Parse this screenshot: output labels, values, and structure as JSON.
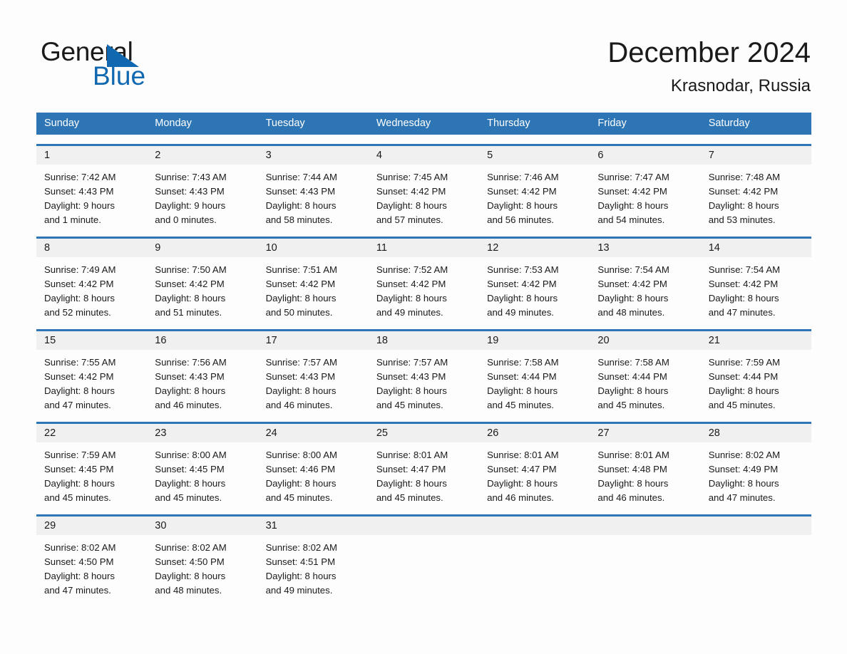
{
  "brand": {
    "name_part1": "General",
    "name_part2": "Blue",
    "accent_color": "#1068b0",
    "triangle_icon": "triangle-icon"
  },
  "header": {
    "month_title": "December 2024",
    "location": "Krasnodar, Russia"
  },
  "calendar": {
    "header_bg_color": "#2e75b6",
    "day_band_bg_color": "#f0f0f0",
    "weekdays": [
      "Sunday",
      "Monday",
      "Tuesday",
      "Wednesday",
      "Thursday",
      "Friday",
      "Saturday"
    ],
    "weeks": [
      [
        {
          "day": "1",
          "sunrise": "Sunrise: 7:42 AM",
          "sunset": "Sunset: 4:43 PM",
          "daylight_1": "Daylight: 9 hours",
          "daylight_2": "and 1 minute."
        },
        {
          "day": "2",
          "sunrise": "Sunrise: 7:43 AM",
          "sunset": "Sunset: 4:43 PM",
          "daylight_1": "Daylight: 9 hours",
          "daylight_2": "and 0 minutes."
        },
        {
          "day": "3",
          "sunrise": "Sunrise: 7:44 AM",
          "sunset": "Sunset: 4:43 PM",
          "daylight_1": "Daylight: 8 hours",
          "daylight_2": "and 58 minutes."
        },
        {
          "day": "4",
          "sunrise": "Sunrise: 7:45 AM",
          "sunset": "Sunset: 4:42 PM",
          "daylight_1": "Daylight: 8 hours",
          "daylight_2": "and 57 minutes."
        },
        {
          "day": "5",
          "sunrise": "Sunrise: 7:46 AM",
          "sunset": "Sunset: 4:42 PM",
          "daylight_1": "Daylight: 8 hours",
          "daylight_2": "and 56 minutes."
        },
        {
          "day": "6",
          "sunrise": "Sunrise: 7:47 AM",
          "sunset": "Sunset: 4:42 PM",
          "daylight_1": "Daylight: 8 hours",
          "daylight_2": "and 54 minutes."
        },
        {
          "day": "7",
          "sunrise": "Sunrise: 7:48 AM",
          "sunset": "Sunset: 4:42 PM",
          "daylight_1": "Daylight: 8 hours",
          "daylight_2": "and 53 minutes."
        }
      ],
      [
        {
          "day": "8",
          "sunrise": "Sunrise: 7:49 AM",
          "sunset": "Sunset: 4:42 PM",
          "daylight_1": "Daylight: 8 hours",
          "daylight_2": "and 52 minutes."
        },
        {
          "day": "9",
          "sunrise": "Sunrise: 7:50 AM",
          "sunset": "Sunset: 4:42 PM",
          "daylight_1": "Daylight: 8 hours",
          "daylight_2": "and 51 minutes."
        },
        {
          "day": "10",
          "sunrise": "Sunrise: 7:51 AM",
          "sunset": "Sunset: 4:42 PM",
          "daylight_1": "Daylight: 8 hours",
          "daylight_2": "and 50 minutes."
        },
        {
          "day": "11",
          "sunrise": "Sunrise: 7:52 AM",
          "sunset": "Sunset: 4:42 PM",
          "daylight_1": "Daylight: 8 hours",
          "daylight_2": "and 49 minutes."
        },
        {
          "day": "12",
          "sunrise": "Sunrise: 7:53 AM",
          "sunset": "Sunset: 4:42 PM",
          "daylight_1": "Daylight: 8 hours",
          "daylight_2": "and 49 minutes."
        },
        {
          "day": "13",
          "sunrise": "Sunrise: 7:54 AM",
          "sunset": "Sunset: 4:42 PM",
          "daylight_1": "Daylight: 8 hours",
          "daylight_2": "and 48 minutes."
        },
        {
          "day": "14",
          "sunrise": "Sunrise: 7:54 AM",
          "sunset": "Sunset: 4:42 PM",
          "daylight_1": "Daylight: 8 hours",
          "daylight_2": "and 47 minutes."
        }
      ],
      [
        {
          "day": "15",
          "sunrise": "Sunrise: 7:55 AM",
          "sunset": "Sunset: 4:42 PM",
          "daylight_1": "Daylight: 8 hours",
          "daylight_2": "and 47 minutes."
        },
        {
          "day": "16",
          "sunrise": "Sunrise: 7:56 AM",
          "sunset": "Sunset: 4:43 PM",
          "daylight_1": "Daylight: 8 hours",
          "daylight_2": "and 46 minutes."
        },
        {
          "day": "17",
          "sunrise": "Sunrise: 7:57 AM",
          "sunset": "Sunset: 4:43 PM",
          "daylight_1": "Daylight: 8 hours",
          "daylight_2": "and 46 minutes."
        },
        {
          "day": "18",
          "sunrise": "Sunrise: 7:57 AM",
          "sunset": "Sunset: 4:43 PM",
          "daylight_1": "Daylight: 8 hours",
          "daylight_2": "and 45 minutes."
        },
        {
          "day": "19",
          "sunrise": "Sunrise: 7:58 AM",
          "sunset": "Sunset: 4:44 PM",
          "daylight_1": "Daylight: 8 hours",
          "daylight_2": "and 45 minutes."
        },
        {
          "day": "20",
          "sunrise": "Sunrise: 7:58 AM",
          "sunset": "Sunset: 4:44 PM",
          "daylight_1": "Daylight: 8 hours",
          "daylight_2": "and 45 minutes."
        },
        {
          "day": "21",
          "sunrise": "Sunrise: 7:59 AM",
          "sunset": "Sunset: 4:44 PM",
          "daylight_1": "Daylight: 8 hours",
          "daylight_2": "and 45 minutes."
        }
      ],
      [
        {
          "day": "22",
          "sunrise": "Sunrise: 7:59 AM",
          "sunset": "Sunset: 4:45 PM",
          "daylight_1": "Daylight: 8 hours",
          "daylight_2": "and 45 minutes."
        },
        {
          "day": "23",
          "sunrise": "Sunrise: 8:00 AM",
          "sunset": "Sunset: 4:45 PM",
          "daylight_1": "Daylight: 8 hours",
          "daylight_2": "and 45 minutes."
        },
        {
          "day": "24",
          "sunrise": "Sunrise: 8:00 AM",
          "sunset": "Sunset: 4:46 PM",
          "daylight_1": "Daylight: 8 hours",
          "daylight_2": "and 45 minutes."
        },
        {
          "day": "25",
          "sunrise": "Sunrise: 8:01 AM",
          "sunset": "Sunset: 4:47 PM",
          "daylight_1": "Daylight: 8 hours",
          "daylight_2": "and 45 minutes."
        },
        {
          "day": "26",
          "sunrise": "Sunrise: 8:01 AM",
          "sunset": "Sunset: 4:47 PM",
          "daylight_1": "Daylight: 8 hours",
          "daylight_2": "and 46 minutes."
        },
        {
          "day": "27",
          "sunrise": "Sunrise: 8:01 AM",
          "sunset": "Sunset: 4:48 PM",
          "daylight_1": "Daylight: 8 hours",
          "daylight_2": "and 46 minutes."
        },
        {
          "day": "28",
          "sunrise": "Sunrise: 8:02 AM",
          "sunset": "Sunset: 4:49 PM",
          "daylight_1": "Daylight: 8 hours",
          "daylight_2": "and 47 minutes."
        }
      ],
      [
        {
          "day": "29",
          "sunrise": "Sunrise: 8:02 AM",
          "sunset": "Sunset: 4:50 PM",
          "daylight_1": "Daylight: 8 hours",
          "daylight_2": "and 47 minutes."
        },
        {
          "day": "30",
          "sunrise": "Sunrise: 8:02 AM",
          "sunset": "Sunset: 4:50 PM",
          "daylight_1": "Daylight: 8 hours",
          "daylight_2": "and 48 minutes."
        },
        {
          "day": "31",
          "sunrise": "Sunrise: 8:02 AM",
          "sunset": "Sunset: 4:51 PM",
          "daylight_1": "Daylight: 8 hours",
          "daylight_2": "and 49 minutes."
        },
        {
          "day": "",
          "sunrise": "",
          "sunset": "",
          "daylight_1": "",
          "daylight_2": ""
        },
        {
          "day": "",
          "sunrise": "",
          "sunset": "",
          "daylight_1": "",
          "daylight_2": ""
        },
        {
          "day": "",
          "sunrise": "",
          "sunset": "",
          "daylight_1": "",
          "daylight_2": ""
        },
        {
          "day": "",
          "sunrise": "",
          "sunset": "",
          "daylight_1": "",
          "daylight_2": ""
        }
      ]
    ]
  }
}
